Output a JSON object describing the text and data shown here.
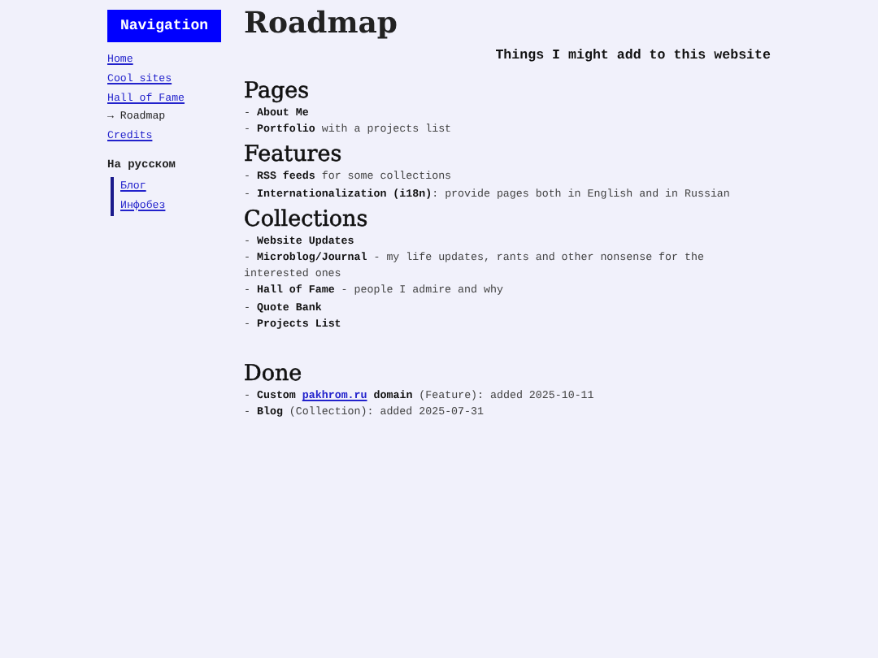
{
  "navigation": {
    "title": "Navigation",
    "links": [
      {
        "label": "Home",
        "current": false
      },
      {
        "label": "Cool sites",
        "current": false
      },
      {
        "label": "Hall of Fame",
        "current": false
      },
      {
        "label": "→ Roadmap",
        "current": true
      },
      {
        "label": "Credits",
        "current": false
      }
    ],
    "russian": {
      "heading": "На русском",
      "links": [
        "Блог",
        "Инфобез"
      ]
    }
  },
  "page": {
    "title": "Roadmap",
    "subtitle": "Things I might add to this website",
    "sections": [
      {
        "heading": "Pages",
        "items": [
          {
            "text": "- **About Me**"
          },
          {
            "text": "- **Portfolio** with a projects list"
          }
        ]
      },
      {
        "heading": "Features",
        "items": [
          {
            "text": "- **RSS feeds** for some collections"
          },
          {
            "text": "- **Internationalization (i18n)**: provide pages both in English and in Russian"
          }
        ]
      },
      {
        "heading": "Collections",
        "items": [
          {
            "text": "- **Website Updates**"
          },
          {
            "text": "- **Microblog/Journal** - my life updates, rants and other nonsense for the interested ones"
          },
          {
            "text": "- **Hall of Fame** - people I admire and why"
          },
          {
            "text": "- **Quote Bank**"
          },
          {
            "text": "- **Projects List**"
          }
        ]
      },
      {
        "heading": "Done",
        "items": [
          {
            "text": "- **Custom** ",
            "link": "pakhrom.ru",
            "after": " **domain** (Feature): added 2025-10-11"
          },
          {
            "text": "- **Blog** (Collection): added 2025-07-31"
          }
        ]
      }
    ]
  }
}
